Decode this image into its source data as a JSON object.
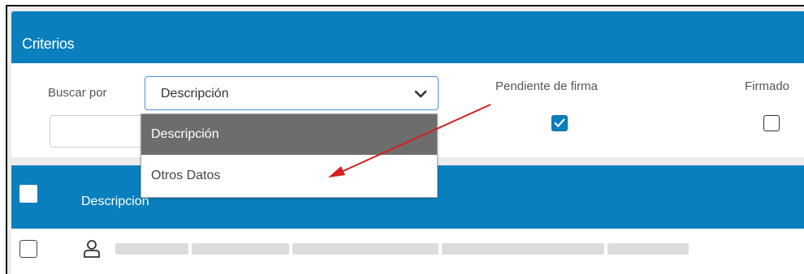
{
  "criteria": {
    "title": "Criterios",
    "search_by_label": "Buscar por",
    "search_by_value": "Descripción",
    "pending_signature_label": "Pendiente de firma",
    "pending_signature_checked": true,
    "signed_label": "Firmado",
    "signed_checked": false
  },
  "dropdown": {
    "options": [
      {
        "label": "Descripción",
        "selected": true
      },
      {
        "label": "Otros Datos",
        "selected": false
      }
    ]
  },
  "table": {
    "columns": [
      "Descripcion"
    ],
    "rows": [
      {
        "checked": false,
        "icon": "user-icon",
        "text_redacted": true
      }
    ]
  },
  "colors": {
    "header_blue": "#0a7fbd",
    "selected_option": "#6d6d6d",
    "annotation_arrow": "#d32020"
  },
  "icons": {
    "select_chevron": "chevron-down-icon",
    "row_user": "user-icon",
    "checkbox_check": "check-icon"
  }
}
